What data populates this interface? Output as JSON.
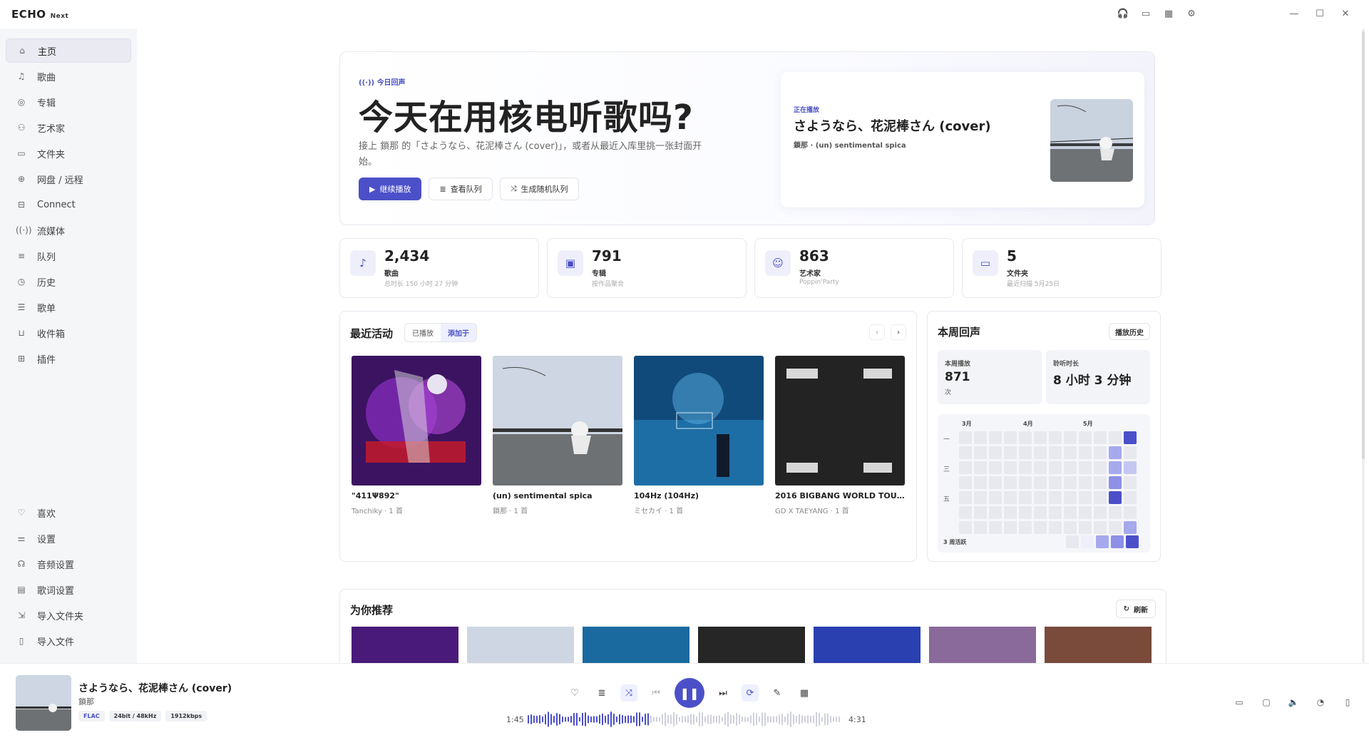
{
  "app": {
    "name": "ECHO",
    "edition": "Next"
  },
  "nav": [
    {
      "label": "主页",
      "icon": "home-icon",
      "active": true
    },
    {
      "label": "歌曲",
      "icon": "music-note-icon"
    },
    {
      "label": "专辑",
      "icon": "disc-icon"
    },
    {
      "label": "艺术家",
      "icon": "users-icon"
    },
    {
      "label": "文件夹",
      "icon": "folder-icon"
    },
    {
      "label": "网盘 / 远程",
      "icon": "globe-icon"
    },
    {
      "label": "Connect",
      "icon": "connect-icon"
    },
    {
      "label": "流媒体",
      "icon": "broadcast-icon"
    },
    {
      "label": "队列",
      "icon": "queue-icon"
    },
    {
      "label": "历史",
      "icon": "history-icon"
    },
    {
      "label": "歌单",
      "icon": "playlist-icon"
    },
    {
      "label": "收件箱",
      "icon": "inbox-icon"
    },
    {
      "label": "插件",
      "icon": "plugin-icon"
    }
  ],
  "nav_bottom": [
    {
      "label": "喜欢",
      "icon": "heart-icon"
    },
    {
      "label": "设置",
      "icon": "sliders-icon"
    },
    {
      "label": "音频设置",
      "icon": "audio-settings-icon"
    },
    {
      "label": "歌词设置",
      "icon": "lyrics-settings-icon"
    },
    {
      "label": "导入文件夹",
      "icon": "import-folder-icon"
    },
    {
      "label": "导入文件",
      "icon": "import-file-icon"
    }
  ],
  "hero": {
    "tag": "今日回声",
    "title": "今天在用核电听歌吗?",
    "subtitle": "接上 鎖那 的「さようなら、花泥棒さん (cover)」，或者从最近入库里挑一张封面开始。",
    "btn_continue": "继续播放",
    "btn_queue": "查看队列",
    "btn_random": "生成随机队列",
    "now_label": "正在播放",
    "now_title": "さようなら、花泥棒さん (cover)",
    "now_artist": "鎖那 · (un) sentimental spica"
  },
  "stats": [
    {
      "num": "2,434",
      "label": "歌曲",
      "sub": "总时长 150 小时 27 分钟",
      "icon": "music-note-icon"
    },
    {
      "num": "791",
      "label": "专辑",
      "sub": "按作品聚合",
      "icon": "album-icon"
    },
    {
      "num": "863",
      "label": "艺术家",
      "sub": "Poppin'Party",
      "icon": "user-icon"
    },
    {
      "num": "5",
      "label": "文件夹",
      "sub": "最近扫描 5月25日",
      "icon": "folder-icon"
    }
  ],
  "recent": {
    "title": "最近活动",
    "tab_played": "已播放",
    "tab_added": "添加于",
    "albums": [
      {
        "title": "\"411Ψ892\"",
        "sub": "Tanchiky · 1 首"
      },
      {
        "title": "(un) sentimental spica",
        "sub": "鎖那 · 1 首"
      },
      {
        "title": "104Hz (104Hz)",
        "sub": "ミセカイ · 1 首"
      },
      {
        "title": "2016 BIGBANG WORLD TOUR [...",
        "sub": "GD X TAEYANG · 1 首"
      }
    ]
  },
  "week": {
    "title": "本周回声",
    "history_btn": "播放历史",
    "plays_label": "本周播放",
    "plays_value": "871",
    "plays_unit": "次",
    "time_label": "聆听时长",
    "time_value": "8 小时 3 分钟",
    "months": [
      "3月",
      "4月",
      "5月"
    ],
    "days": [
      "一",
      "三",
      "五"
    ],
    "footer": "3 周活跃"
  },
  "recommend": {
    "title": "为你推荐",
    "refresh": "刷新"
  },
  "player": {
    "title": "さようなら、花泥棒さん (cover)",
    "artist": "鎖那",
    "format": "FLAC",
    "sample": "24bit / 48kHz",
    "bitrate": "1912kbps",
    "elapsed": "1:45",
    "total": "4:31",
    "progress": 0.387
  },
  "colors": {
    "accent": "#4b50c9",
    "accent_light": "#eef0ff"
  }
}
